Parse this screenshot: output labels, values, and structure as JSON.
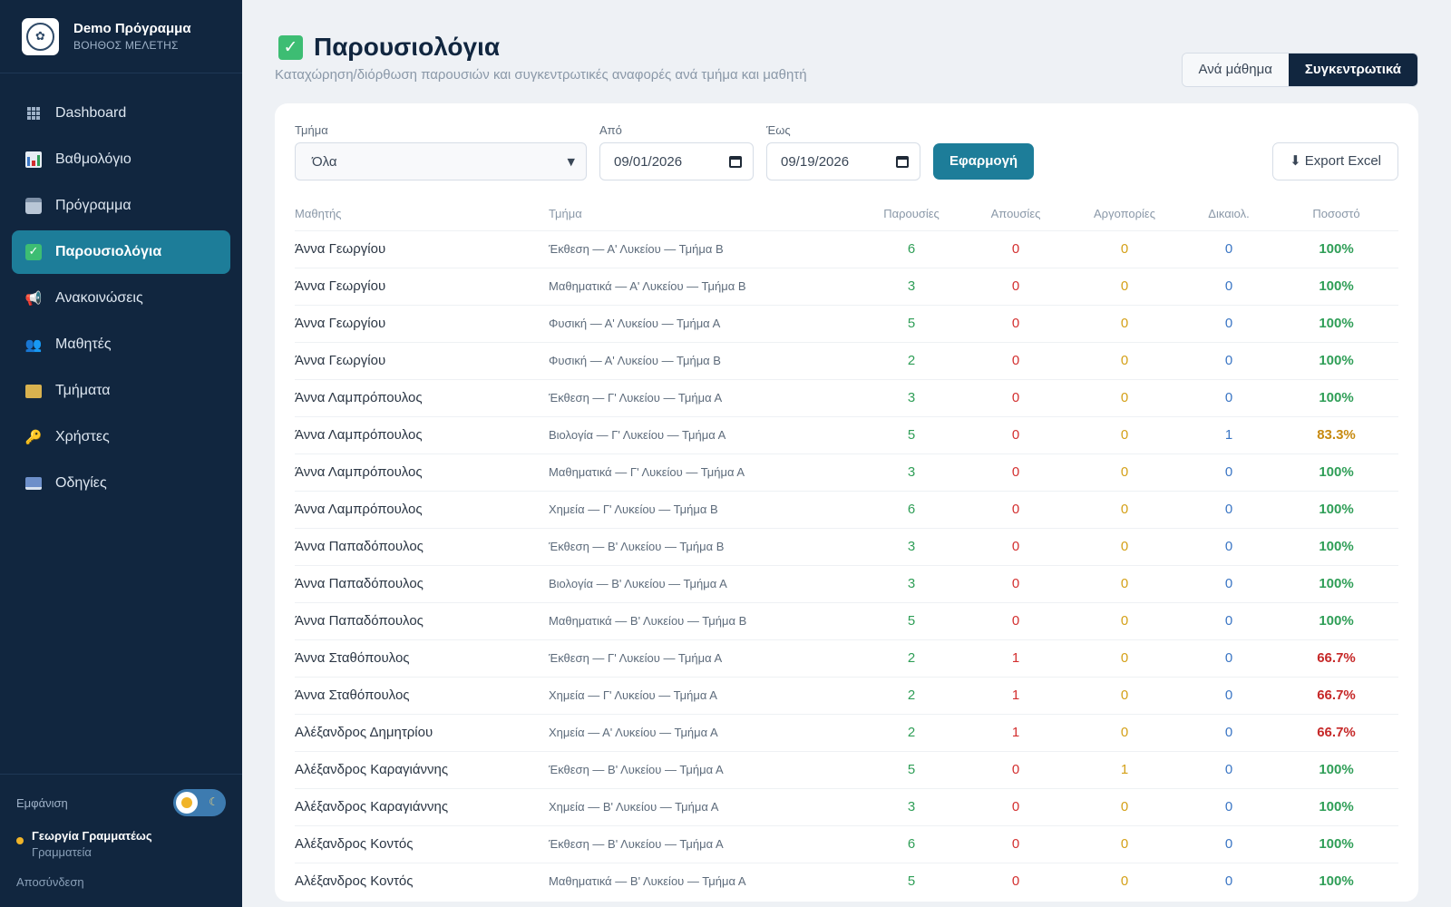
{
  "brand": {
    "title": "Demo Πρόγραμμα",
    "subtitle": "ΒΟΗΘΟΣ ΜΕΛΕΤΗΣ"
  },
  "sidebar": {
    "items": [
      {
        "label": "Dashboard",
        "icon": "grid-icon"
      },
      {
        "label": "Βαθμολόγιο",
        "icon": "bar-chart-icon"
      },
      {
        "label": "Πρόγραμμα",
        "icon": "calendar-icon"
      },
      {
        "label": "Παρουσιολόγια",
        "icon": "checkbox-icon",
        "active": true
      },
      {
        "label": "Ανακοινώσεις",
        "icon": "megaphone-icon"
      },
      {
        "label": "Μαθητές",
        "icon": "users-icon"
      },
      {
        "label": "Τμήματα",
        "icon": "folder-icon"
      },
      {
        "label": "Χρήστες",
        "icon": "key-icon"
      },
      {
        "label": "Οδηγίες",
        "icon": "book-icon"
      }
    ],
    "appearance_label": "Εμφάνιση",
    "user": {
      "name": "Γεωργία Γραμματέως",
      "role": "Γραμματεία"
    },
    "logout_label": "Αποσύνδεση"
  },
  "header": {
    "title": "Παρουσιολόγια",
    "subtitle": "Καταχώρηση/διόρθωση παρουσιών και συγκεντρωτικές αναφορές ανά τμήμα και μαθητή",
    "view_toggle": {
      "per_lesson": "Ανά μάθημα",
      "summary": "Συγκεντρωτικά",
      "selected": "summary"
    }
  },
  "filters": {
    "class_label": "Τμήμα",
    "class_value": "Όλα",
    "from_label": "Από",
    "from_value": "09/01/2026",
    "to_label": "Έως",
    "to_value": "09/19/2026",
    "apply_label": "Εφαρμογή",
    "export_label": "⬇ Export Excel"
  },
  "table": {
    "headers": {
      "student": "Μαθητής",
      "class": "Τμήμα",
      "present": "Παρουσίες",
      "absent": "Απουσίες",
      "late": "Αργοπορίες",
      "justified": "Δικαιολ.",
      "percent": "Ποσοστό"
    },
    "rows": [
      {
        "student": "Άννα Γεωργίου",
        "class": "Έκθεση — Α' Λυκείου — Τμήμα Β",
        "present": "6",
        "absent": "0",
        "late": "0",
        "justified": "0",
        "percent": "100%"
      },
      {
        "student": "Άννα Γεωργίου",
        "class": "Μαθηματικά — Α' Λυκείου — Τμήμα Β",
        "present": "3",
        "absent": "0",
        "late": "0",
        "justified": "0",
        "percent": "100%"
      },
      {
        "student": "Άννα Γεωργίου",
        "class": "Φυσική — Α' Λυκείου — Τμήμα Α",
        "present": "5",
        "absent": "0",
        "late": "0",
        "justified": "0",
        "percent": "100%"
      },
      {
        "student": "Άννα Γεωργίου",
        "class": "Φυσική — Α' Λυκείου — Τμήμα Β",
        "present": "2",
        "absent": "0",
        "late": "0",
        "justified": "0",
        "percent": "100%"
      },
      {
        "student": "Άννα Λαμπρόπουλος",
        "class": "Έκθεση — Γ' Λυκείου — Τμήμα Α",
        "present": "3",
        "absent": "0",
        "late": "0",
        "justified": "0",
        "percent": "100%"
      },
      {
        "student": "Άννα Λαμπρόπουλος",
        "class": "Βιολογία — Γ' Λυκείου — Τμήμα Α",
        "present": "5",
        "absent": "0",
        "late": "0",
        "justified": "1",
        "percent": "83.3%"
      },
      {
        "student": "Άννα Λαμπρόπουλος",
        "class": "Μαθηματικά — Γ' Λυκείου — Τμήμα Α",
        "present": "3",
        "absent": "0",
        "late": "0",
        "justified": "0",
        "percent": "100%"
      },
      {
        "student": "Άννα Λαμπρόπουλος",
        "class": "Χημεία — Γ' Λυκείου — Τμήμα Β",
        "present": "6",
        "absent": "0",
        "late": "0",
        "justified": "0",
        "percent": "100%"
      },
      {
        "student": "Άννα Παπαδόπουλος",
        "class": "Έκθεση — Β' Λυκείου — Τμήμα Β",
        "present": "3",
        "absent": "0",
        "late": "0",
        "justified": "0",
        "percent": "100%"
      },
      {
        "student": "Άννα Παπαδόπουλος",
        "class": "Βιολογία — Β' Λυκείου — Τμήμα Α",
        "present": "3",
        "absent": "0",
        "late": "0",
        "justified": "0",
        "percent": "100%"
      },
      {
        "student": "Άννα Παπαδόπουλος",
        "class": "Μαθηματικά — Β' Λυκείου — Τμήμα Β",
        "present": "5",
        "absent": "0",
        "late": "0",
        "justified": "0",
        "percent": "100%"
      },
      {
        "student": "Άννα Σταθόπουλος",
        "class": "Έκθεση — Γ' Λυκείου — Τμήμα Α",
        "present": "2",
        "absent": "1",
        "late": "0",
        "justified": "0",
        "percent": "66.7%"
      },
      {
        "student": "Άννα Σταθόπουλος",
        "class": "Χημεία — Γ' Λυκείου — Τμήμα Α",
        "present": "2",
        "absent": "1",
        "late": "0",
        "justified": "0",
        "percent": "66.7%"
      },
      {
        "student": "Αλέξανδρος Δημητρίου",
        "class": "Χημεία — Α' Λυκείου — Τμήμα Α",
        "present": "2",
        "absent": "1",
        "late": "0",
        "justified": "0",
        "percent": "66.7%"
      },
      {
        "student": "Αλέξανδρος Καραγιάννης",
        "class": "Έκθεση — Β' Λυκείου — Τμήμα Α",
        "present": "5",
        "absent": "0",
        "late": "1",
        "justified": "0",
        "percent": "100%"
      },
      {
        "student": "Αλέξανδρος Καραγιάννης",
        "class": "Χημεία — Β' Λυκείου — Τμήμα Α",
        "present": "3",
        "absent": "0",
        "late": "0",
        "justified": "0",
        "percent": "100%"
      },
      {
        "student": "Αλέξανδρος Κοντός",
        "class": "Έκθεση — Β' Λυκείου — Τμήμα Α",
        "present": "6",
        "absent": "0",
        "late": "0",
        "justified": "0",
        "percent": "100%"
      },
      {
        "student": "Αλέξανδρος Κοντός",
        "class": "Μαθηματικά — Β' Λυκείου — Τμήμα Α",
        "present": "5",
        "absent": "0",
        "late": "0",
        "justified": "0",
        "percent": "100%"
      }
    ]
  },
  "colors": {
    "sidebar_bg": "#11263f",
    "accent": "#1d7d99",
    "present": "#2f9e57",
    "absent": "#d32f2f",
    "late": "#d4a017",
    "justified": "#3a75c4"
  }
}
